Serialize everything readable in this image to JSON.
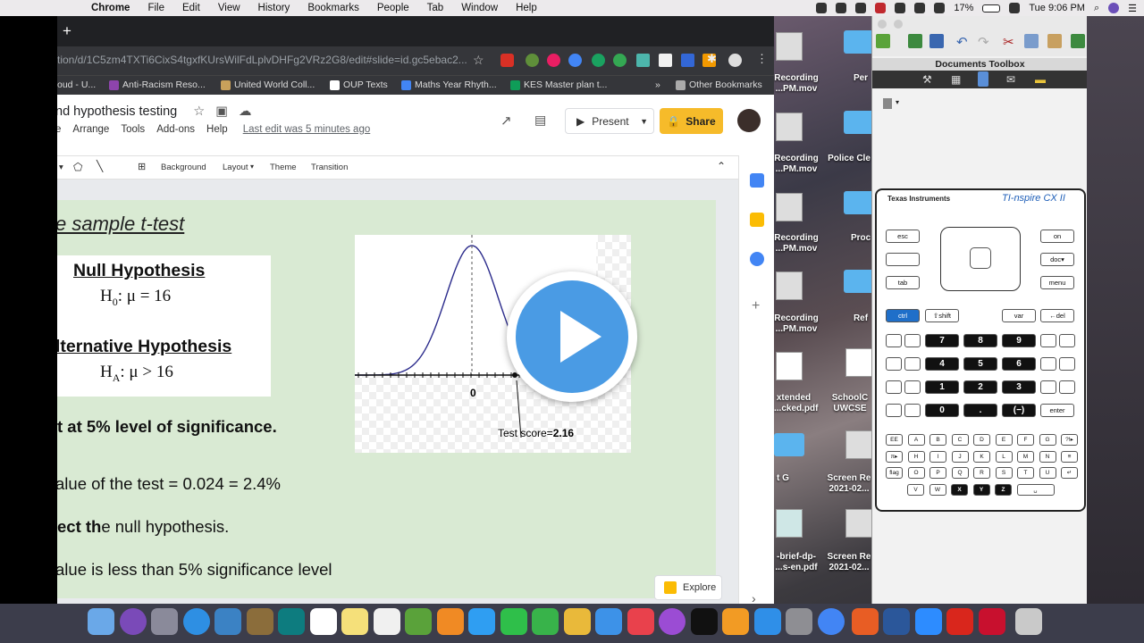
{
  "menubar": {
    "app": "Chrome",
    "items": [
      "File",
      "Edit",
      "View",
      "History",
      "Bookmarks",
      "People",
      "Tab",
      "Window",
      "Help"
    ],
    "battery": "17%",
    "time": "Tue 9:06 PM"
  },
  "browser": {
    "url": "tion/d/1C5zm4TXTi6CixS4tgxfKUrsWilFdLplvDHFg2VRz2G8/edit#slide=id.gc5ebac2...",
    "bookmarks": [
      "oud - U...",
      "Anti-Racism Reso...",
      "United World Coll...",
      "OUP Texts",
      "Maths Year Rhyth...",
      "KES Master plan t..."
    ],
    "more": "»",
    "other": "Other Bookmarks"
  },
  "doc": {
    "title": "nd hypothesis testing",
    "menus": [
      "e",
      "Arrange",
      "Tools",
      "Add-ons",
      "Help"
    ],
    "last_edit": "Last edit was 5 minutes ago",
    "present": "Present",
    "share": "Share",
    "toolbar": {
      "background": "Background",
      "layout": "Layout",
      "theme": "Theme",
      "transition": "Transition"
    },
    "explore": "Explore"
  },
  "slide": {
    "title": "e sample t-test",
    "null_heading": "Null Hypothesis",
    "null_formula": "H0:  μ = 16",
    "null_sym": "H",
    "null_sub": "0",
    "null_rest": ":  μ = 16",
    "alt_heading": "lternative Hypothesis",
    "alt_sym": "H",
    "alt_sub": "A",
    "alt_rest": ":  μ > 16",
    "sig_line": "t at 5% level of significance.",
    "pvalue_line": "alue of the test = 0.024 = 2.4%",
    "reject_bold": "ect th",
    "reject_rest": "e null hypothesis.",
    "reason_line": "alue is less than 5% significance level",
    "graph": {
      "zero_label": "0",
      "score_label": "Test score=",
      "score_value": "2.16"
    }
  },
  "desktop": {
    "items": [
      "Recording\n...PM.mov",
      "Recording\n...PM.mov",
      "Recording\n...PM.mov",
      "Recording\n...PM.mov",
      "xtended\n...cked.pdf",
      "t G",
      "-brief-dp-\n...s-en.pdf"
    ],
    "col2": [
      "Per",
      "Police Cle",
      "Proc",
      "Ref",
      "SchoolC\nUWCSE",
      "Screen Re\n2021-02...",
      "Screen Re\n2021-02..."
    ]
  },
  "ti": {
    "header": "Documents Toolbox",
    "brand": "Texas Instruments",
    "model": "TI-nspire CX II",
    "keys_top": [
      "esc",
      "on",
      "doc▾",
      "tab",
      "menu",
      "ctrl",
      "⇧shift",
      "var",
      "←del"
    ],
    "numbers": [
      "7",
      "8",
      "9",
      "4",
      "5",
      "6",
      "1",
      "2",
      "3",
      "0",
      ".",
      "(−)",
      "enter"
    ],
    "letters": [
      "EE",
      "A",
      "B",
      "C",
      "D",
      "E",
      "F",
      "G",
      "?!▸",
      "π▸",
      "H",
      "I",
      "J",
      "K",
      "L",
      "M",
      "N",
      "≡",
      "flag",
      "O",
      "P",
      "Q",
      "R",
      "S",
      "T",
      "U",
      "↵",
      "V",
      "W",
      "X",
      "Y",
      "Z",
      "␣"
    ]
  },
  "colors": {
    "slide_bg": "#d9ead3",
    "share": "#f6bb2a",
    "play": "#4a9be4",
    "curve": "#2c2c8c"
  }
}
